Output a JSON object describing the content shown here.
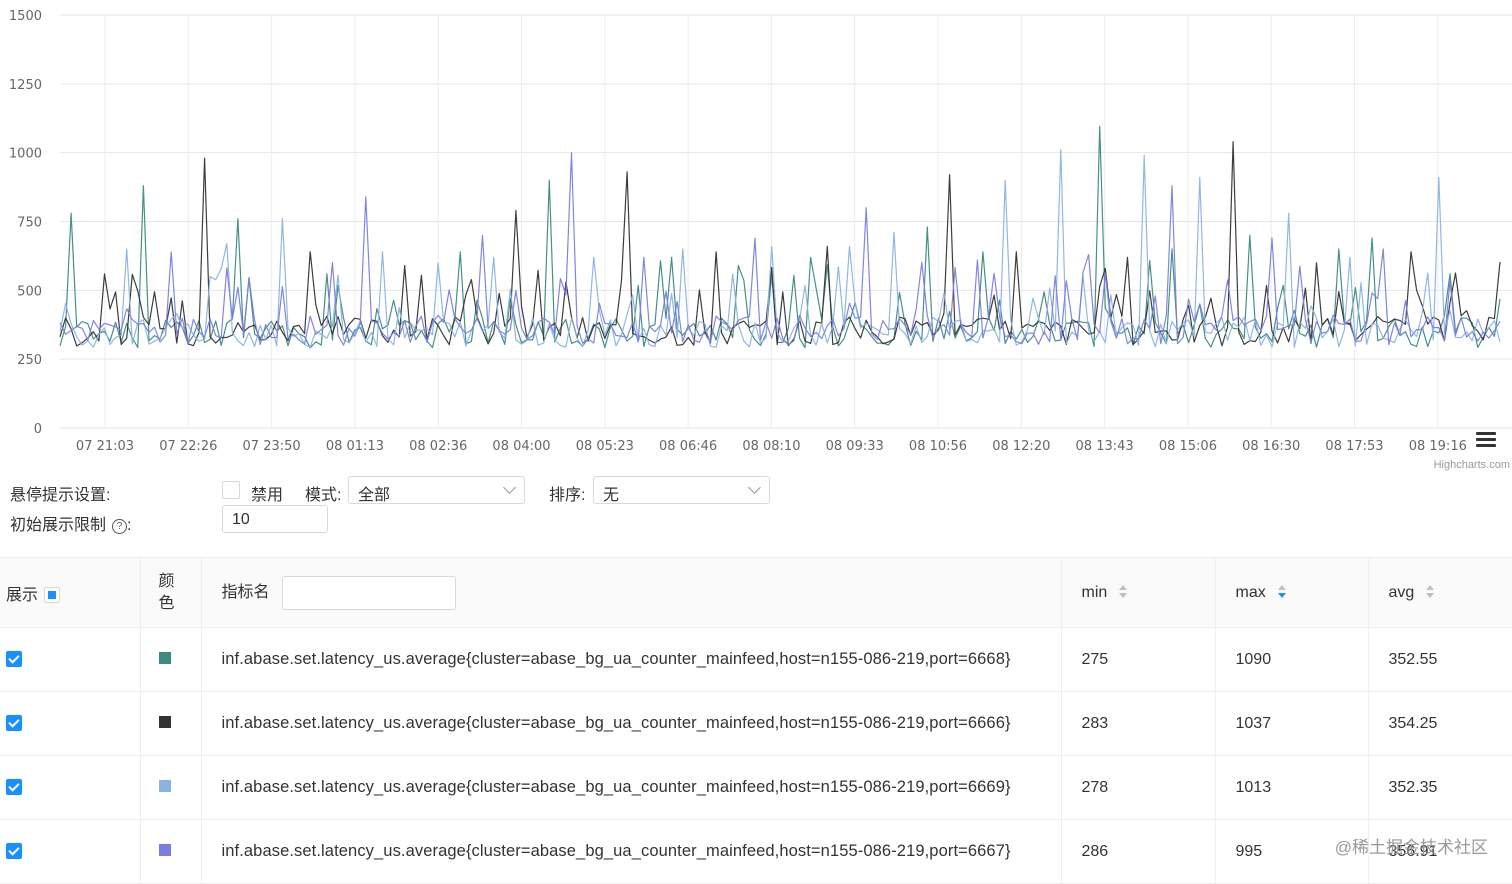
{
  "chart_data": {
    "type": "line",
    "y_ticks": [
      0,
      250,
      500,
      750,
      1000,
      1250,
      1500
    ],
    "ylim": [
      0,
      1500
    ],
    "x_ticks": [
      "07 21:03",
      "07 22:26",
      "07 23:50",
      "08 01:13",
      "08 02:36",
      "08 04:00",
      "08 05:23",
      "08 06:46",
      "08 08:10",
      "08 09:33",
      "08 10:56",
      "08 12:20",
      "08 13:43",
      "08 15:06",
      "08 16:30",
      "08 17:53",
      "08 19:16"
    ],
    "grid": true,
    "series": [
      {
        "name": "inf.abase.set.latency_us.average{cluster=abase_bg_ua_counter_mainfeed,host=n155-086-219,port=6668}",
        "color": "#3d8a80",
        "min": 275,
        "max": 1090,
        "avg": 352.55,
        "spikes": [
          [
            2,
            780
          ],
          [
            15,
            880
          ],
          [
            32,
            760
          ],
          [
            48,
            560
          ],
          [
            72,
            640
          ],
          [
            88,
            900
          ],
          [
            110,
            620
          ],
          [
            122,
            590
          ],
          [
            135,
            620
          ],
          [
            156,
            730
          ],
          [
            166,
            640
          ],
          [
            187,
            1095
          ],
          [
            200,
            650
          ],
          [
            214,
            700
          ],
          [
            230,
            650
          ],
          [
            236,
            690
          ],
          [
            250,
            560
          ]
        ]
      },
      {
        "name": "inf.abase.set.latency_us.average{cluster=abase_bg_ua_counter_mainfeed,host=n155-086-219,port=6666}",
        "color": "#333333",
        "min": 283,
        "max": 1037,
        "avg": 354.25,
        "spikes": [
          [
            8,
            560
          ],
          [
            26,
            980
          ],
          [
            45,
            640
          ],
          [
            62,
            590
          ],
          [
            82,
            790
          ],
          [
            102,
            930
          ],
          [
            118,
            640
          ],
          [
            138,
            660
          ],
          [
            160,
            920
          ],
          [
            172,
            640
          ],
          [
            192,
            620
          ],
          [
            211,
            1040
          ],
          [
            226,
            600
          ],
          [
            243,
            640
          ]
        ]
      },
      {
        "name": "inf.abase.set.latency_us.average{cluster=abase_bg_ua_counter_mainfeed,host=n155-086-219,port=6669}",
        "color": "#8ab4e0",
        "min": 278,
        "max": 1013,
        "avg": 352.35,
        "spikes": [
          [
            12,
            650
          ],
          [
            30,
            670
          ],
          [
            40,
            760
          ],
          [
            58,
            640
          ],
          [
            68,
            600
          ],
          [
            78,
            620
          ],
          [
            96,
            620
          ],
          [
            112,
            650
          ],
          [
            128,
            660
          ],
          [
            142,
            660
          ],
          [
            150,
            710
          ],
          [
            170,
            900
          ],
          [
            180,
            1010
          ],
          [
            195,
            990
          ],
          [
            205,
            910
          ],
          [
            221,
            780
          ],
          [
            232,
            620
          ],
          [
            248,
            910
          ]
        ]
      },
      {
        "name": "inf.abase.set.latency_us.average{cluster=abase_bg_ua_counter_mainfeed,host=n155-086-219,port=6667}",
        "color": "#7b7ee0",
        "min": 286,
        "max": 995,
        "avg": 356.91,
        "spikes": [
          [
            20,
            640
          ],
          [
            55,
            840
          ],
          [
            76,
            700
          ],
          [
            92,
            1000
          ],
          [
            105,
            620
          ],
          [
            125,
            690
          ],
          [
            145,
            800
          ],
          [
            165,
            610
          ],
          [
            185,
            630
          ],
          [
            200,
            880
          ],
          [
            218,
            690
          ],
          [
            238,
            650
          ]
        ]
      }
    ]
  },
  "credits": "Highcharts.com",
  "settings": {
    "hover_label": "悬停提示设置:",
    "disable_label": "禁用",
    "mode_label": "模式:",
    "mode_value": "全部",
    "sort_label": "排序:",
    "sort_value": "无",
    "limit_label": "初始展示限制",
    "help_glyph": "?",
    "limit_value": "10"
  },
  "table": {
    "headers": {
      "show": "展示",
      "color": "颜色",
      "name": "指标名",
      "min": "min",
      "max": "max",
      "avg": "avg"
    },
    "rows": [
      {
        "color": "#3d8a80",
        "name": "inf.abase.set.latency_us.average{cluster=abase_bg_ua_counter_mainfeed,host=n155-086-219,port=6668}",
        "min": "275",
        "max": "1090",
        "avg": "352.55"
      },
      {
        "color": "#333333",
        "name": "inf.abase.set.latency_us.average{cluster=abase_bg_ua_counter_mainfeed,host=n155-086-219,port=6666}",
        "min": "283",
        "max": "1037",
        "avg": "354.25"
      },
      {
        "color": "#8ab4e0",
        "name": "inf.abase.set.latency_us.average{cluster=abase_bg_ua_counter_mainfeed,host=n155-086-219,port=6669}",
        "min": "278",
        "max": "1013",
        "avg": "352.35"
      },
      {
        "color": "#7b7ee0",
        "name": "inf.abase.set.latency_us.average{cluster=abase_bg_ua_counter_mainfeed,host=n155-086-219,port=6667}",
        "min": "286",
        "max": "995",
        "avg": "356.91"
      }
    ]
  },
  "watermark": "@稀土掘金技术社区"
}
